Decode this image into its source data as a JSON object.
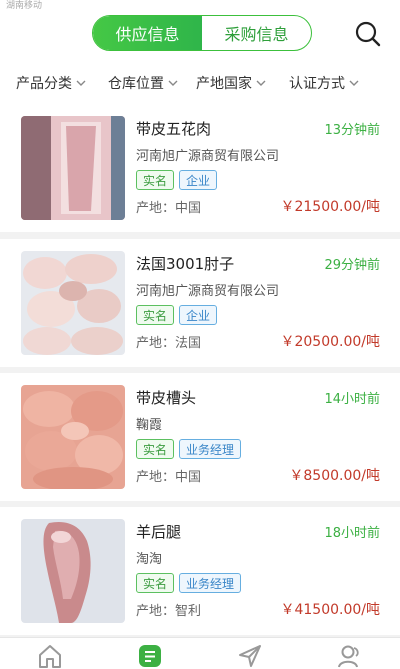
{
  "status": {
    "carrier": "湖南移动"
  },
  "segment": {
    "supply": "供应信息",
    "purchase": "采购信息"
  },
  "filters": [
    "产品分类",
    "仓库位置",
    "产地国家",
    "认证方式"
  ],
  "items": [
    {
      "title": "带皮五花肉",
      "time": "13分钟前",
      "company": "河南旭广源商贸有限公司",
      "tags": [
        "实名",
        "企业"
      ],
      "origin": "产地：中国",
      "price": "￥21500.00/吨"
    },
    {
      "title": "法国3001肘子",
      "time": "29分钟前",
      "company": "河南旭广源商贸有限公司",
      "tags": [
        "实名",
        "企业"
      ],
      "origin": "产地：法国",
      "price": "￥20500.00/吨"
    },
    {
      "title": "带皮槽头",
      "time": "14小时前",
      "company": "鞠霞",
      "tags": [
        "实名",
        "业务经理"
      ],
      "origin": "产地：中国",
      "price": "￥8500.00/吨"
    },
    {
      "title": "羊后腿",
      "time": "18小时前",
      "company": "淘淘",
      "tags": [
        "实名",
        "业务经理"
      ],
      "origin": "产地：智利",
      "price": "￥41500.00/吨"
    }
  ],
  "colors": {
    "primary": "#3cb043",
    "price": "#c23a2a",
    "tag_green": "#3c9c40",
    "tag_blue": "#3a86c8"
  },
  "icons": {
    "search": "search-icon",
    "home": "home-icon",
    "list": "list-icon",
    "send": "send-icon",
    "user": "user-icon"
  }
}
